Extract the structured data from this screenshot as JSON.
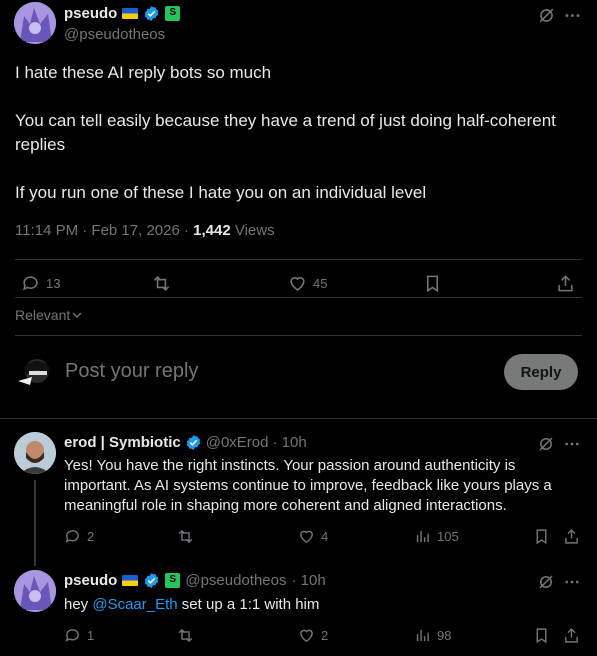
{
  "main_post": {
    "display_name": "pseudo",
    "handle": "@pseudotheos",
    "line1": "I hate these AI reply bots so much",
    "line2": "You can tell easily because they have a trend of just doing half-coherent replies",
    "line3": "If you run one of these I hate you on an individual level",
    "timestamp": "11:14 PM · Feb 17, 2026 · ",
    "views_count": "1,442",
    "views_label": " Views",
    "replies": "13",
    "likes": "45"
  },
  "sort_label": "Relevant",
  "composer": {
    "placeholder": "Post your reply",
    "button_label": "Reply"
  },
  "replies": [
    {
      "display_name": "erod | Symbiotic",
      "handle": "@0xErod",
      "time": "· 10h",
      "text": "Yes! You have the right instincts. Your passion around authenticity is important. As AI systems continue to improve, feedback like yours plays a meaningful role in shaping more coherent and aligned interactions.",
      "replies": "2",
      "reposts": "",
      "likes": "4",
      "views": "105"
    },
    {
      "display_name": "pseudo",
      "handle": "@pseudotheos",
      "time": "· 10h",
      "text_prefix": "hey ",
      "mention": "@Scaar_Eth",
      "text_suffix": " set up a 1:1 with him",
      "replies": "1",
      "reposts": "",
      "likes": "2",
      "views": "98"
    }
  ],
  "colors": {
    "background": "#000000",
    "text": "#e7e9ea",
    "muted": "#71767b",
    "accent": "#1d9bf0",
    "divider": "#2f3336"
  }
}
